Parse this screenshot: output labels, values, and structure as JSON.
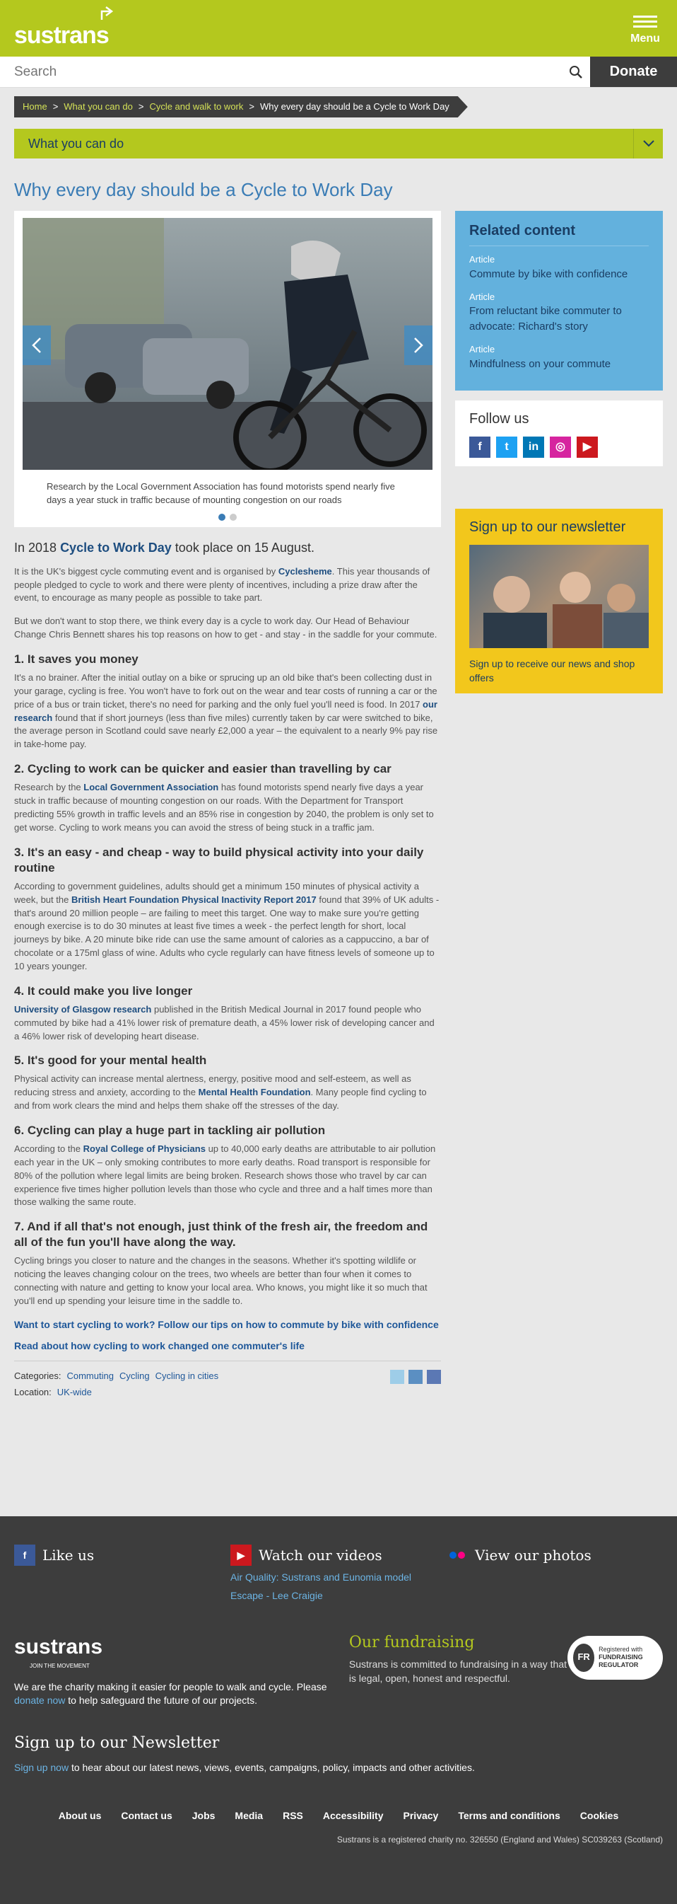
{
  "header": {
    "logo": "sustrans",
    "menu_label": "Menu"
  },
  "search": {
    "placeholder": "Search",
    "donate_label": "Donate"
  },
  "breadcrumb": [
    "Home",
    "What you can do",
    "Cycle and walk to work",
    "Why every day should be a Cycle to Work Day"
  ],
  "section_nav": {
    "label": "What you can do"
  },
  "page": {
    "title": "Why every day should be a Cycle to Work Day",
    "hero_caption": "Research by the Local Government Association has found motorists spend nearly five days a year stuck in traffic because of mounting congestion on our roads",
    "intro_pre": "In 2018 ",
    "intro_link": "Cycle to Work Day",
    "intro_post": " took place on 15 August.",
    "p1_pre": "It is the UK's biggest cycle commuting event and is organised by ",
    "p1_link": "Cyclesheme",
    "p1_post": ". This year thousands of people pledged to cycle to work and there were plenty of incentives, including a prize draw after the event, to encourage as many people as possible to take part.",
    "p2": "But we don't want to stop there, we think every day is a cycle to work day. Our Head of Behaviour Change Chris Bennett shares his top reasons on how to get - and stay - in the saddle for your commute.",
    "s1_title": "1. It saves you money",
    "s1_pre": "It's a no brainer. After the initial outlay on a bike or sprucing up an old bike that's been collecting dust in your garage, cycling is free. You won't have to fork out on the wear and tear costs of running a car or the price of a bus or train ticket, there's no need for parking and the only fuel you'll need is food. In 2017 ",
    "s1_link": "our research",
    "s1_post": " found that if short journeys (less than five miles) currently taken by car were switched to bike, the average person in Scotland could save nearly £2,000 a year – the equivalent to a nearly 9% pay rise in take-home pay.",
    "s2_title": "2. Cycling to work can be quicker and easier than travelling by car",
    "s2_pre": "Research by the ",
    "s2_link": "Local Government Association",
    "s2_post": " has found motorists spend nearly five days a year stuck in traffic because of mounting congestion on our roads. With the Department for Transport predicting 55% growth in traffic levels and an 85% rise in congestion by 2040, the problem is only set to get worse. Cycling to work means you can avoid the stress of being stuck in a traffic jam.",
    "s3_title": "3. It's an easy - and cheap - way to build physical activity into your daily routine",
    "s3_pre": "According to government guidelines, adults should get a minimum 150 minutes of physical activity a week, but the ",
    "s3_link": "British Heart Foundation Physical Inactivity Report 2017",
    "s3_post": " found that 39% of UK adults - that's around 20 million people – are failing to meet this target. One way to make sure you're getting enough exercise is to do 30 minutes at least five times a week - the perfect length for short, local journeys by bike. A 20 minute bike ride can use the same amount of calories as a cappuccino, a bar of chocolate or a 175ml glass of wine. Adults who cycle regularly can have fitness levels of someone up to 10 years younger.",
    "s4_title": "4. It could make you live longer",
    "s4_link": "University of Glasgow research",
    "s4_post": " published in the British Medical Journal in 2017 found people who commuted by bike had a 41% lower risk of premature death, a 45% lower risk of developing cancer and a 46% lower risk of developing heart disease.",
    "s5_title": "5. It's good for your mental health",
    "s5_pre": "Physical activity can increase mental alertness, energy, positive mood and self-esteem, as well as reducing stress and anxiety, according to the ",
    "s5_link": "Mental Health Foundation",
    "s5_post": ". Many people find cycling to and from work clears the mind and helps them shake off the stresses of the day.",
    "s6_title": "6. Cycling can play a huge part in tackling air pollution",
    "s6_pre": "According to the ",
    "s6_link": "Royal College of Physicians",
    "s6_post": " up to 40,000 early deaths are attributable to air pollution each year in the UK – only smoking contributes to more early deaths. Road transport is responsible for 80% of the pollution where legal limits are being broken. Research shows those who travel by car can experience five times higher pollution levels than those who cycle and three and a half times more than those walking the same route.",
    "s7_title": "7. And if all that's not enough, just think of the fresh air, the freedom and all of the fun you'll have along the way.",
    "s7_body": "Cycling brings you closer to nature and the changes in the seasons. Whether it's spotting wildlife or noticing the leaves changing colour on the trees, two wheels are better than four when it comes to connecting with nature and getting to know your local area. Who knows, you might like it so much that you'll end up spending your leisure time in the saddle to.",
    "cta1": "Want to start cycling to work? Follow our tips on how to commute by bike with confidence",
    "cta2": "Read about how cycling to work changed one commuter's life",
    "categories_label": "Categories:",
    "categories": [
      "Commuting",
      "Cycling",
      "Cycling in cities"
    ],
    "location_label": "Location:",
    "location": "UK-wide"
  },
  "related": {
    "title": "Related content",
    "items": [
      {
        "kind": "Article",
        "title": "Commute by bike with confidence"
      },
      {
        "kind": "Article",
        "title": "From reluctant bike commuter to advocate: Richard's story"
      },
      {
        "kind": "Article",
        "title": "Mindfulness on your commute"
      }
    ]
  },
  "follow": {
    "title": "Follow us"
  },
  "newsletter": {
    "title": "Sign up to our newsletter",
    "body": "Sign up to receive our news and shop offers"
  },
  "footer": {
    "like_us": "Like us",
    "watch": "Watch our videos",
    "videos": [
      "Air Quality: Sustrans and Eunomia model",
      "Escape - Lee Craigie"
    ],
    "photos": "View our photos",
    "logo": "sustrans",
    "tagline": "JOIN THE MOVEMENT",
    "about_pre": "We are the charity making it easier for people to walk and cycle. Please ",
    "about_link": "donate now",
    "about_post": " to help safeguard the future of our projects.",
    "fund_title": "Our fundraising",
    "fund_body": "Sustrans is committed to fundraising in a way that is legal, open, honest and respectful.",
    "fr_badge": "FR",
    "fr_text1": "Registered with",
    "fr_text2": "FUNDRAISING REGULATOR",
    "news_title": "Sign up to our Newsletter",
    "news_link": "Sign up now",
    "news_post": " to hear about our latest news, views, events, campaigns, policy, impacts and other activities.",
    "nav": [
      "About us",
      "Contact us",
      "Jobs",
      "Media",
      "RSS",
      "Accessibility",
      "Privacy",
      "Terms and conditions",
      "Cookies"
    ],
    "legal": "Sustrans is a registered charity no. 326550 (England and Wales) SC039263 (Scotland)"
  },
  "colors": {
    "brand_green": "#b4c81e",
    "dark": "#3d3d3d",
    "related_blue": "#63b1dd",
    "newsletter_yellow": "#f2c71c"
  }
}
